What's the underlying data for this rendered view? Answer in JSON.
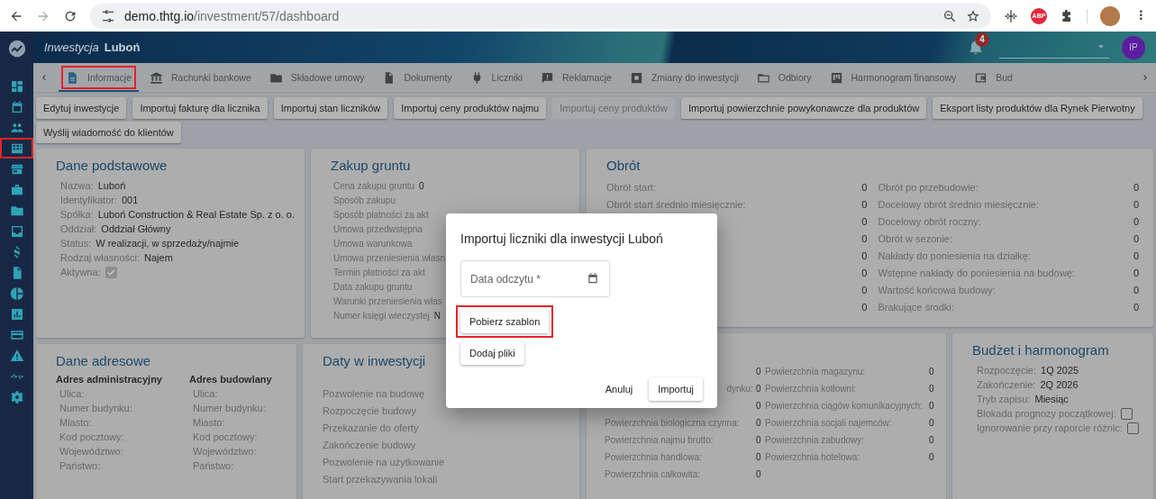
{
  "browser": {
    "url_host": "demo.thtg.io",
    "url_path": "/investment/57/dashboard",
    "extension_badge": "ABP"
  },
  "sidebar": {
    "items": [
      {
        "highlighted": false
      },
      {
        "highlighted": false
      },
      {
        "highlighted": false
      },
      {
        "highlighted": true
      },
      {
        "highlighted": false
      },
      {
        "highlighted": false
      },
      {
        "highlighted": false
      },
      {
        "highlighted": false
      },
      {
        "highlighted": false
      },
      {
        "highlighted": false
      },
      {
        "highlighted": false
      },
      {
        "highlighted": false
      },
      {
        "highlighted": false
      },
      {
        "highlighted": false
      },
      {
        "highlighted": false
      },
      {
        "highlighted": false
      }
    ]
  },
  "header": {
    "title_prefix": "Inwestycja",
    "title": "Luboń",
    "notifications": "4",
    "user_initials": "IP"
  },
  "tabs": [
    {
      "label": "Informacje",
      "selected": true,
      "highlighted": true
    },
    {
      "label": "Rachunki bankowe",
      "selected": false,
      "highlighted": false
    },
    {
      "label": "Składowe umowy",
      "selected": false,
      "highlighted": false
    },
    {
      "label": "Dokumenty",
      "selected": false,
      "highlighted": false
    },
    {
      "label": "Liczniki",
      "selected": false,
      "highlighted": false
    },
    {
      "label": "Reklamacje",
      "selected": false,
      "highlighted": false
    },
    {
      "label": "Zmiany do inwestycji",
      "selected": false,
      "highlighted": false
    },
    {
      "label": "Odbiory",
      "selected": false,
      "highlighted": false
    },
    {
      "label": "Harmonogram finansowy",
      "selected": false,
      "highlighted": false
    },
    {
      "label": "Bud",
      "selected": false,
      "highlighted": false
    }
  ],
  "actions": [
    {
      "label": "Edytuj inwestycje",
      "disabled": false
    },
    {
      "label": "Importuj fakturę dla licznika",
      "disabled": false
    },
    {
      "label": "Importuj stan liczników",
      "disabled": false
    },
    {
      "label": "Importuj ceny produktów najmu",
      "disabled": false
    },
    {
      "label": "Importuj ceny produktów",
      "disabled": true
    },
    {
      "label": "Importuj powierzchnie powykonawcze dla produktów",
      "disabled": false
    },
    {
      "label": "Eksport listy produktów dla Rynek Pierwotny",
      "disabled": false
    },
    {
      "label": "Wyślij wiadomość do klientów",
      "disabled": false
    }
  ],
  "basic": {
    "title": "Dane podstawowe",
    "rows": [
      {
        "label": "Nazwa:",
        "value": "Luboń"
      },
      {
        "label": "Identyfikator:",
        "value": "001"
      },
      {
        "label": "Spółka:",
        "value": "Luboń Construction & Real Estate Sp. z o. o."
      },
      {
        "label": "Oddział:",
        "value": "Oddział Główny"
      },
      {
        "label": "Status:",
        "value": "W realizacji, w sprzedaży/najmie"
      },
      {
        "label": "Rodzaj własności:",
        "value": "Najem"
      }
    ],
    "active": {
      "label": "Aktywna:",
      "checked": true
    }
  },
  "land": {
    "title": "Zakup gruntu",
    "rows": [
      {
        "label": "Cena zakupu gruntu",
        "value": "0"
      },
      {
        "label": "Sposób zakupu"
      },
      {
        "label": "Sposób płatności za akt"
      },
      {
        "label": "Umowa przedwstępna"
      },
      {
        "label": "Umowa warunkowa"
      },
      {
        "label": "Umowa przeniesienia własn"
      },
      {
        "label": "Termin płatności za akt"
      },
      {
        "label": "Data zakupu gruntu"
      },
      {
        "label": "Warunki przeniesienia włas"
      },
      {
        "label": "Numer księgi wieczystej",
        "value": "N"
      }
    ]
  },
  "turnover": {
    "title": "Obrót",
    "left": [
      {
        "label": "Obrót start:",
        "value": "0"
      },
      {
        "label": "Obrót start średnio miesięcznie:",
        "value": "0"
      },
      {
        "value": "0"
      },
      {
        "value": "0"
      },
      {
        "value": "0"
      },
      {
        "value": "0"
      },
      {
        "value": "0"
      },
      {
        "value": "0"
      }
    ],
    "right": [
      {
        "label": "Obrót po przebudowie:",
        "value": "0"
      },
      {
        "label": "Docelowy obrót średnio miesięcznie:",
        "value": "0"
      },
      {
        "label": "Docelowy obrót roczny:",
        "value": "0"
      },
      {
        "label": "Obrót w sezonie:",
        "value": "0"
      },
      {
        "label": "Nakłady do poniesienia na działkę:",
        "value": "0"
      },
      {
        "label": "Wstępne nakłady do poniesienia na budowę:",
        "value": "0"
      },
      {
        "label": "Wartość końcowa budowy:",
        "value": "0"
      },
      {
        "label": "Brakujące środki:",
        "value": "0"
      }
    ]
  },
  "address": {
    "title": "Dane adresowe",
    "columns": [
      {
        "heading": "Adres administracyjny",
        "labels": [
          "Ulica:",
          "Numer budynku:",
          "Miasto:",
          "Kod pocztowy:",
          "Województwo:",
          "Państwo:"
        ]
      },
      {
        "heading": "Adres budowlany",
        "labels": [
          "Ulica:",
          "Numer budynku:",
          "Miasto:",
          "Kod pocztowy:",
          "Województwo:",
          "Państwo:"
        ]
      }
    ]
  },
  "dates": {
    "title": "Daty w inwestycji",
    "rows": [
      "Pozwolenie na budowę",
      "Rozpoczęcie budowy",
      "Przekazanie do oferty",
      "Zakończenie budowy",
      "Pozwolenie na użytkowanie",
      "Start przekazywania lokali"
    ]
  },
  "areas": {
    "rows": [
      {
        "kind": "covered",
        "value": "0",
        "right_label": "Powierzchnia magazynu:",
        "right_value": "0"
      },
      {
        "kind": "clipped",
        "label": "dynku:",
        "value": "0",
        "right_label": "Powierzchnia kotłowni:",
        "right_value": "0"
      },
      {
        "kind": "covered",
        "value": "0",
        "right_label": "Powierzchnia ciągów komunikacyjnych:",
        "right_value": "0"
      },
      {
        "kind": "full",
        "label": "Powierzchnia biologiczna czynna:",
        "value": "0",
        "right_label": "Powierzchnia socjali najemców:",
        "right_value": "0"
      },
      {
        "kind": "full",
        "label": "Powierzchnia najmu brutto:",
        "value": "0",
        "right_label": "Powierzchnia zabudowy:",
        "right_value": "0"
      },
      {
        "kind": "full",
        "label": "Powierzchnia handlowa:",
        "value": "0",
        "right_label": "Powierzchnia hotelowa:",
        "right_value": "0"
      },
      {
        "kind": "full",
        "label": "Powierzchnia całkowita:",
        "value": "0"
      }
    ]
  },
  "budget": {
    "title": "Budżet i harmonogram",
    "rows": [
      {
        "label": "Rozpoczęcie:",
        "value": "1Q 2025"
      },
      {
        "label": "Zakończenie:",
        "value": "2Q 2026"
      },
      {
        "label": "Tryb zapisu:",
        "value": "Miesiąc"
      }
    ],
    "checks": [
      {
        "label": "Blokada prognozy początkowej:",
        "checked": false
      },
      {
        "label": "Ignorowanie przy raporcie różnic:",
        "checked": false
      }
    ]
  },
  "dialog": {
    "title": "Importuj liczniki dla inwestycji Luboń",
    "field": {
      "placeholder": "Data odczytu *"
    },
    "buttons": [
      {
        "label": "Pobierz szablon",
        "highlighted": true
      },
      {
        "label": "Dodaj pliki",
        "highlighted": false
      }
    ],
    "cancel": "Anuluj",
    "confirm": "Importuj"
  }
}
